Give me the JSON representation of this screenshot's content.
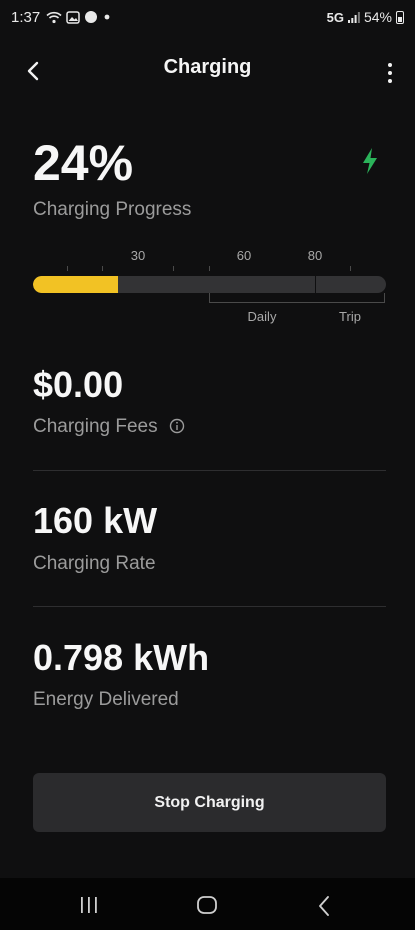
{
  "status_bar": {
    "time": "1:37",
    "network": "5G",
    "battery": "54%",
    "left_icons": [
      "wifi-icon",
      "gallery-icon",
      "messenger-icon",
      "dot-icon"
    ]
  },
  "header": {
    "title": "Charging",
    "back_icon": "chevron-left-icon",
    "menu_icon": "more-vertical-icon"
  },
  "progress": {
    "value_text": "24%",
    "label": "Charging Progress",
    "fraction": 0.24,
    "ticks": [
      "30",
      "60",
      "80"
    ],
    "ranges": [
      "Daily",
      "Trip"
    ],
    "fill_color": "#f2c224",
    "bolt_color": "#2bb35a"
  },
  "fees": {
    "value": "$0.00",
    "label": "Charging Fees"
  },
  "rate": {
    "value": "160 kW",
    "label": "Charging Rate"
  },
  "energy": {
    "value": "0.798 kWh",
    "label": "Energy Delivered"
  },
  "actions": {
    "stop_label": "Stop Charging"
  },
  "nav": {
    "icons": [
      "recent-apps-icon",
      "home-icon",
      "back-icon"
    ]
  }
}
